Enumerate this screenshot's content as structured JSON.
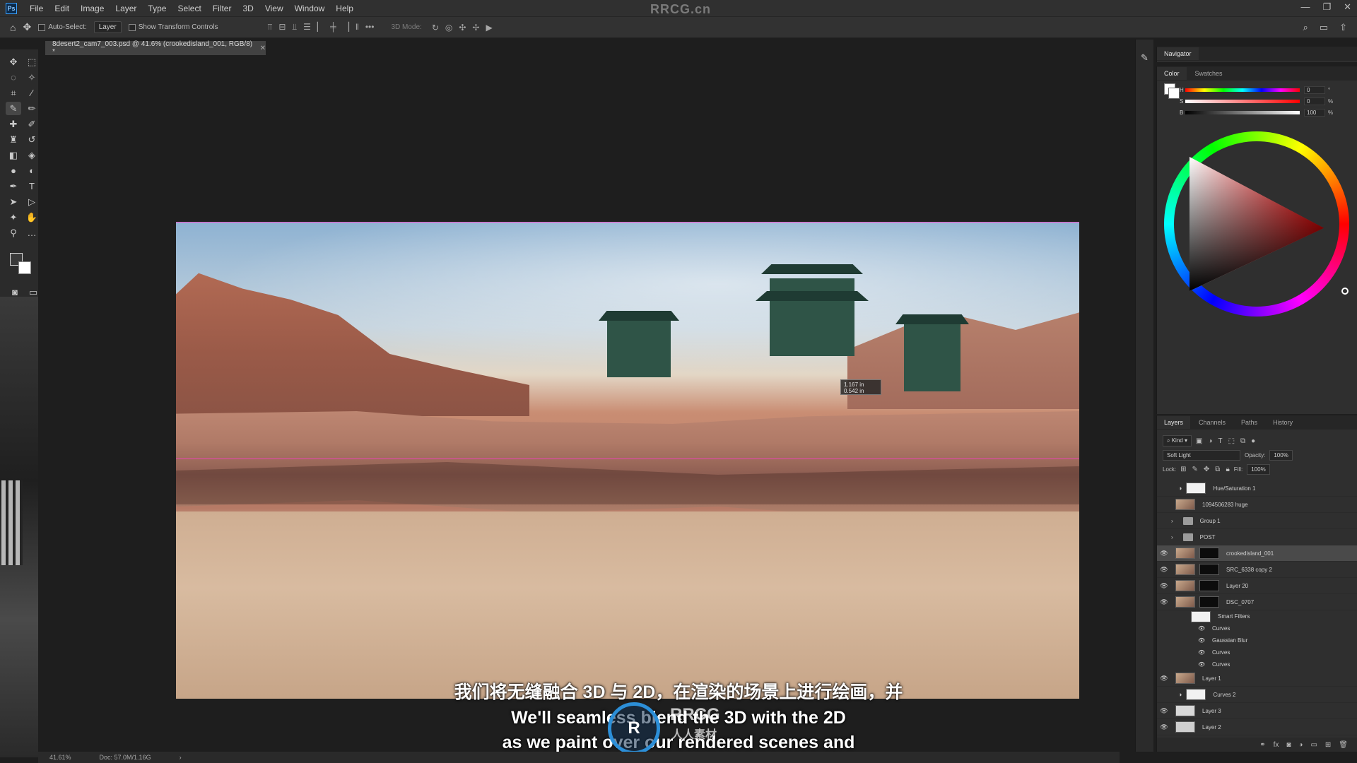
{
  "app": {
    "logo": "Ps",
    "title": "RRCG.cn",
    "menu": [
      "File",
      "Edit",
      "Image",
      "Layer",
      "Type",
      "Select",
      "Filter",
      "3D",
      "View",
      "Window",
      "Help"
    ]
  },
  "options_bar": {
    "auto_select_label": "Auto-Select:",
    "auto_select_target": "Layer",
    "show_transform_label": "Show Transform Controls",
    "mode_3d_label": "3D Mode:"
  },
  "document": {
    "tab_title": "8desert2_cam7_003.psd @ 41.6% (crookedisland_001, RGB/8) *",
    "zoom_status": "41.61%",
    "doc_status": "Doc: 57.0M/1.16G"
  },
  "measure_tooltip": {
    "line1": "1.167 in",
    "line2": "0.542 in"
  },
  "subtitles": {
    "chinese": "我们将无缝融合 3D 与 2D，在渲染的场景上进行绘画，并",
    "english_line1": "We'll seamless blend the 3D with the 2D",
    "english_line2": "as we paint over our rendered scenes and"
  },
  "watermark": {
    "brand": "RRCG",
    "brand_cn": "人人素材"
  },
  "panels": {
    "navigator_tab": "Navigator",
    "color_tabs": [
      "Color",
      "Swatches"
    ],
    "hsb": [
      {
        "label": "H",
        "value": "0",
        "unit": "°"
      },
      {
        "label": "S",
        "value": "0",
        "unit": "%"
      },
      {
        "label": "B",
        "value": "100",
        "unit": "%"
      }
    ],
    "layer_tabs": [
      "Layers",
      "Channels",
      "Paths",
      "History"
    ],
    "kind_label": "Kind",
    "blend_mode": "Soft Light",
    "opacity_label": "Opacity:",
    "opacity_value": "100%",
    "lock_label": "Lock:",
    "fill_label": "Fill:",
    "fill_value": "100%"
  },
  "layers": [
    {
      "name": "Hue/Saturation 1",
      "kind": "adjustment",
      "visible": false
    },
    {
      "name": "1094506283 huge",
      "kind": "pixel",
      "visible": false
    },
    {
      "name": "Group 1",
      "kind": "group",
      "visible": false
    },
    {
      "name": "POST",
      "kind": "group",
      "visible": false
    },
    {
      "name": "crookedisland_001",
      "kind": "masked",
      "visible": true,
      "selected": true
    },
    {
      "name": "SRC_6338 copy 2",
      "kind": "masked",
      "visible": true
    },
    {
      "name": "Layer 20",
      "kind": "masked",
      "visible": true
    },
    {
      "name": "DSC_0707",
      "kind": "masked",
      "visible": true
    },
    {
      "name": "Smart Filters",
      "kind": "smartfilters",
      "visible": true
    },
    {
      "name": "Curves",
      "kind": "filter",
      "visible": true
    },
    {
      "name": "Gaussian Blur",
      "kind": "filter",
      "visible": true
    },
    {
      "name": "Curves",
      "kind": "filter",
      "visible": true
    },
    {
      "name": "Curves",
      "kind": "filter",
      "visible": true
    },
    {
      "name": "Layer 1",
      "kind": "pixel",
      "visible": true
    },
    {
      "name": "Curves 2",
      "kind": "adjustment",
      "visible": true
    },
    {
      "name": "Layer 3",
      "kind": "pixel",
      "visible": true
    },
    {
      "name": "Layer 2",
      "kind": "pixel",
      "visible": true
    }
  ],
  "colors": {
    "guide": "#ff3cc8",
    "accent": "#2c8fd8"
  }
}
